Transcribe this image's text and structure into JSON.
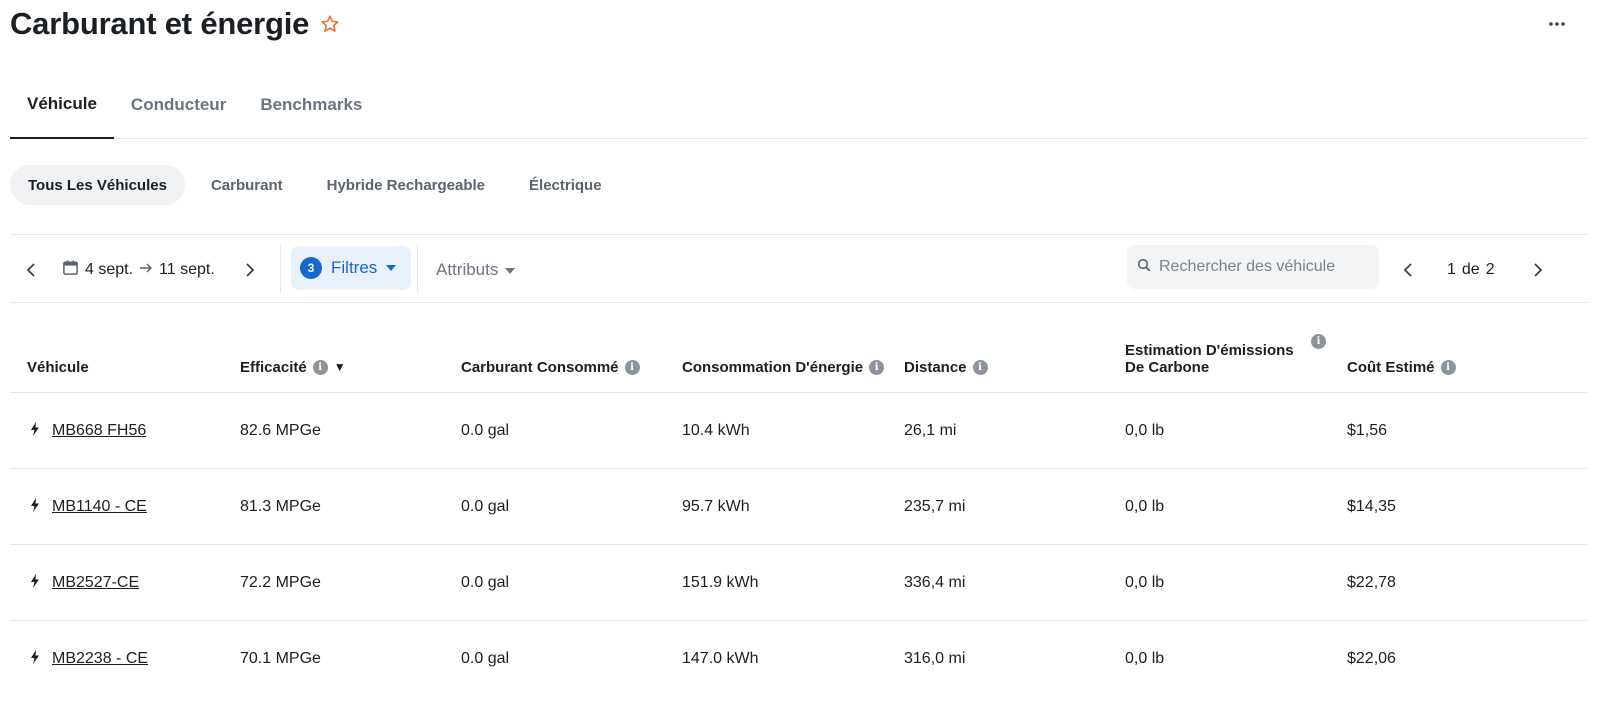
{
  "page": {
    "title": "Carburant et énergie"
  },
  "tabs": [
    {
      "label": "Véhicule",
      "active": true
    },
    {
      "label": "Conducteur",
      "active": false
    },
    {
      "label": "Benchmarks",
      "active": false
    }
  ],
  "segments": [
    {
      "label": "Tous Les Véhicules",
      "active": true
    },
    {
      "label": "Carburant",
      "active": false
    },
    {
      "label": "Hybride Rechargeable",
      "active": false
    },
    {
      "label": "Électrique",
      "active": false
    }
  ],
  "toolbar": {
    "date_start": "4 sept.",
    "date_end": "11 sept.",
    "filters_count": "3",
    "filters_label": "Filtres",
    "attributes_label": "Attributs",
    "search_placeholder": "Rechercher des véhicule",
    "page_current": "1",
    "page_of": "de",
    "page_total": "2"
  },
  "table": {
    "columns": [
      {
        "label": "Véhicule",
        "info": false,
        "sort": false
      },
      {
        "label": "Efficacité",
        "info": true,
        "sort": true
      },
      {
        "label": "Carburant Consommé",
        "info": true,
        "sort": false
      },
      {
        "label": "Consommation D'énergie",
        "info": true,
        "sort": false
      },
      {
        "label": "Distance",
        "info": true,
        "sort": false
      },
      {
        "label": "Estimation D'émissions De Carbone",
        "info": true,
        "sort": false
      },
      {
        "label": "Coût Estimé",
        "info": true,
        "sort": false
      }
    ],
    "sort_indicator": "▼",
    "rows": [
      {
        "vehicle": "MB668 FH56",
        "efficiency": "82.6 MPGe",
        "fuel": "0.0 gal",
        "energy": "10.4 kWh",
        "distance": "26,1 mi",
        "carbon": "0,0 lb",
        "cost": "$1,56"
      },
      {
        "vehicle": "MB1140 - CE",
        "efficiency": "81.3 MPGe",
        "fuel": "0.0 gal",
        "energy": "95.7 kWh",
        "distance": "235,7 mi",
        "carbon": "0,0 lb",
        "cost": "$14,35"
      },
      {
        "vehicle": "MB2527-CE",
        "efficiency": "72.2 MPGe",
        "fuel": "0.0 gal",
        "energy": "151.9 kWh",
        "distance": "336,4 mi",
        "carbon": "0,0 lb",
        "cost": "$22,78"
      },
      {
        "vehicle": "MB2238 - CE",
        "efficiency": "70.1 MPGe",
        "fuel": "0.0 gal",
        "energy": "147.0 kWh",
        "distance": "316,0 mi",
        "carbon": "0,0 lb",
        "cost": "$22,06"
      }
    ]
  },
  "colors": {
    "accent": "#1668c9",
    "star": "#e8772e",
    "border": "#e3e6ea",
    "muted": "#6b7480"
  },
  "icons": [
    "star-icon",
    "more-icon",
    "chevron-left-icon",
    "chevron-right-icon",
    "calendar-icon",
    "arrow-right-icon",
    "caret-down-icon",
    "search-icon",
    "info-icon",
    "bolt-icon"
  ]
}
